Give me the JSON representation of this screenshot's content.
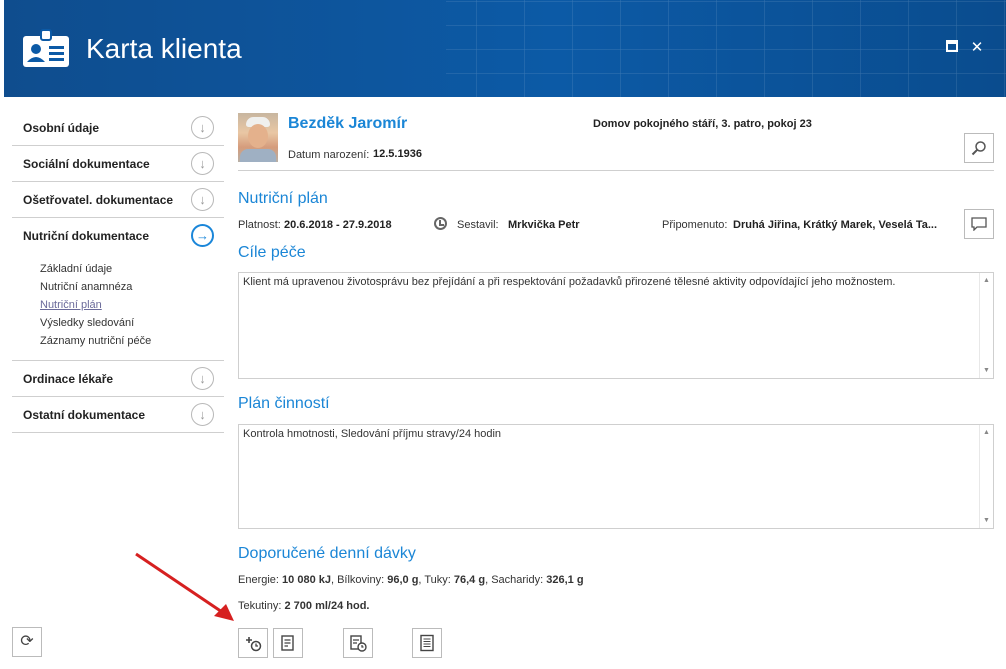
{
  "window": {
    "title": "Karta klienta",
    "maximize_icon": "maximize-icon",
    "close_icon": "close-icon"
  },
  "sidebar": {
    "sections": [
      {
        "label": "Osobní údaje",
        "icon": "arrow-down-circle-icon"
      },
      {
        "label": "Sociální dokumentace",
        "icon": "arrow-down-circle-icon"
      },
      {
        "label": "Ošetřovatel. dokumentace",
        "icon": "arrow-down-circle-icon"
      },
      {
        "label": "Nutriční dokumentace",
        "icon": "arrow-right-circle-icon",
        "expanded": true
      },
      {
        "label": "Ordinace lékaře",
        "icon": "arrow-down-circle-icon"
      },
      {
        "label": "Ostatní dokumentace",
        "icon": "arrow-down-circle-icon"
      }
    ],
    "subitems": [
      "Základní údaje",
      "Nutriční anamnéza",
      "Nutriční plán",
      "Výsledky sledování",
      "Záznamy nutriční péče"
    ],
    "selected_subitem": "Nutriční plán"
  },
  "client": {
    "name": "Bezděk Jaromír",
    "dob_label": "Datum narození:",
    "dob": "12.5.1936",
    "facility": "Domov pokojného stáří, 3. patro, pokoj 23"
  },
  "plan": {
    "heading": "Nutriční plán",
    "validity_label": "Platnost:",
    "validity": "20.6.2018 - 27.9.2018",
    "author_label": "Sestavil:",
    "author": "Mrkvička Petr",
    "commented_label": "Připomenuto:",
    "commented": "Druhá Jiřina, Krátký Marek, Veselá Ta..."
  },
  "goals": {
    "heading": "Cíle péče",
    "text": "Klient má upravenou životosprávu bez přejídání a při respektování požadavků přirozené tělesné aktivity odpovídající jeho možnostem."
  },
  "activities": {
    "heading": "Plán činností",
    "text": "Kontrola hmotnosti, Sledování příjmu stravy/24 hodin"
  },
  "doses": {
    "heading": "Doporučené denní dávky",
    "energy_label": "Energie:",
    "energy": "10 080 kJ",
    "protein_label": ", Bílkoviny:",
    "protein": "96,0 g",
    "fat_label": ", Tuky:",
    "fat": "76,4 g",
    "carbs_label": ", Sacharidy:",
    "carbs": "326,1 g",
    "fluids_label": "Tekutiny:",
    "fluids": "2 700 ml/24 hod."
  },
  "toolbar": {
    "icons": [
      "add-scheduled-icon",
      "edit-document-icon",
      "document-history-icon",
      "document-list-icon"
    ],
    "refresh_icon": "refresh-icon",
    "search_icon": "search-icon",
    "comment_icon": "comment-icon"
  },
  "colors": {
    "header": "#0c5aa6",
    "accent": "#1b86d6",
    "annotation_arrow": "#d62020"
  }
}
